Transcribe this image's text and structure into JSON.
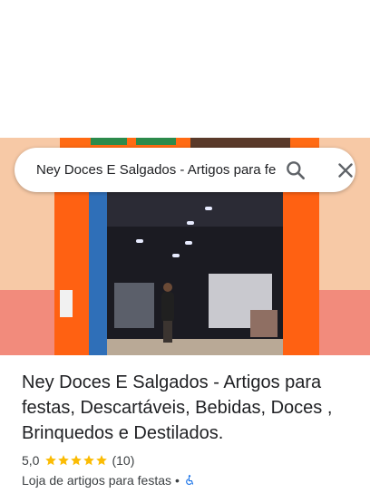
{
  "search": {
    "query": "Ney Doces E Salgados - Artigos para festas"
  },
  "place": {
    "title": "Ney Doces E Salgados - Artigos para festas, Descartáveis, Bebidas, Doces , Brinquedos e Destilados.",
    "rating": "5,0",
    "stars": 5,
    "review_count": "(10)",
    "category": "Loja de artigos para festas",
    "separator": "•"
  },
  "icons": {
    "search": "search-icon",
    "close": "close-icon",
    "star": "star-icon",
    "accessible": "wheelchair-icon"
  },
  "colors": {
    "star": "#fbbc04",
    "accessible": "#1a73e8",
    "storefront_orange": "#ff6112"
  }
}
